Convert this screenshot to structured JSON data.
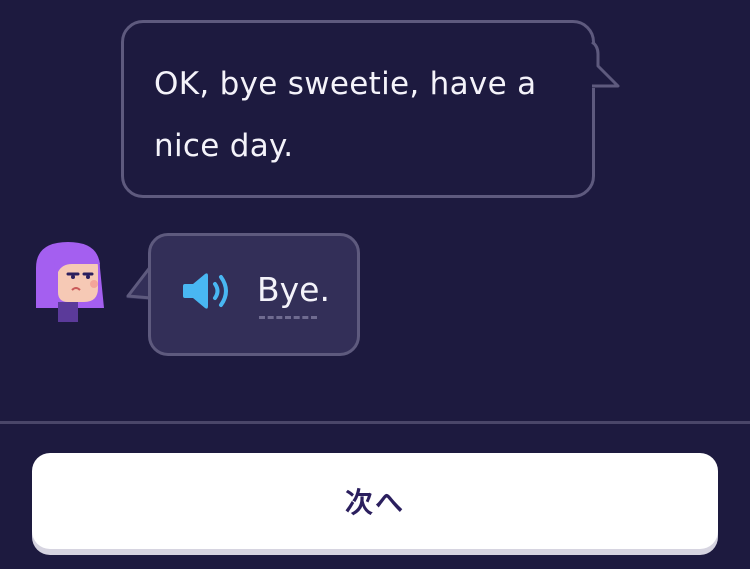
{
  "conversation": {
    "prompt_text": "OK, bye sweetie, have a nice day.",
    "response": {
      "text": "Bye.",
      "audio_icon": "speaker-icon"
    }
  },
  "footer": {
    "next_label": "次へ"
  },
  "colors": {
    "background": "#1d1a3f",
    "bubble_border": "#5e5a7e",
    "response_bubble_bg": "#332f58",
    "speaker_blue": "#49b7f2",
    "avatar_hair": "#a45ff0",
    "button_bg": "#ffffff",
    "button_text": "#2b1f5e"
  }
}
